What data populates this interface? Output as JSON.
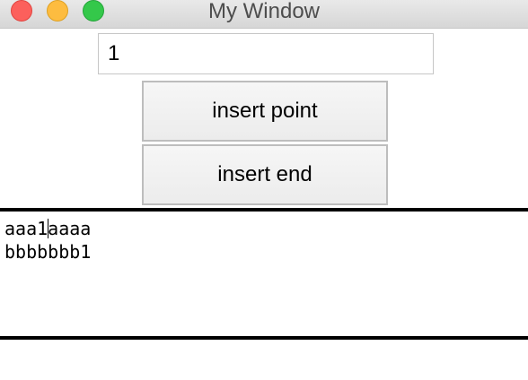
{
  "window": {
    "title": "My Window",
    "controls": {
      "close_color": "#fc605c",
      "minimize_color": "#fdbc40",
      "zoom_color": "#34c84a"
    }
  },
  "entry": {
    "value": "1"
  },
  "buttons": {
    "insert_point": "insert point",
    "insert_end": "insert end"
  },
  "text_area": {
    "line1_before_cursor": "aaa1",
    "line1_after_cursor": "aaaa",
    "line2": "bbbbbbb1"
  }
}
